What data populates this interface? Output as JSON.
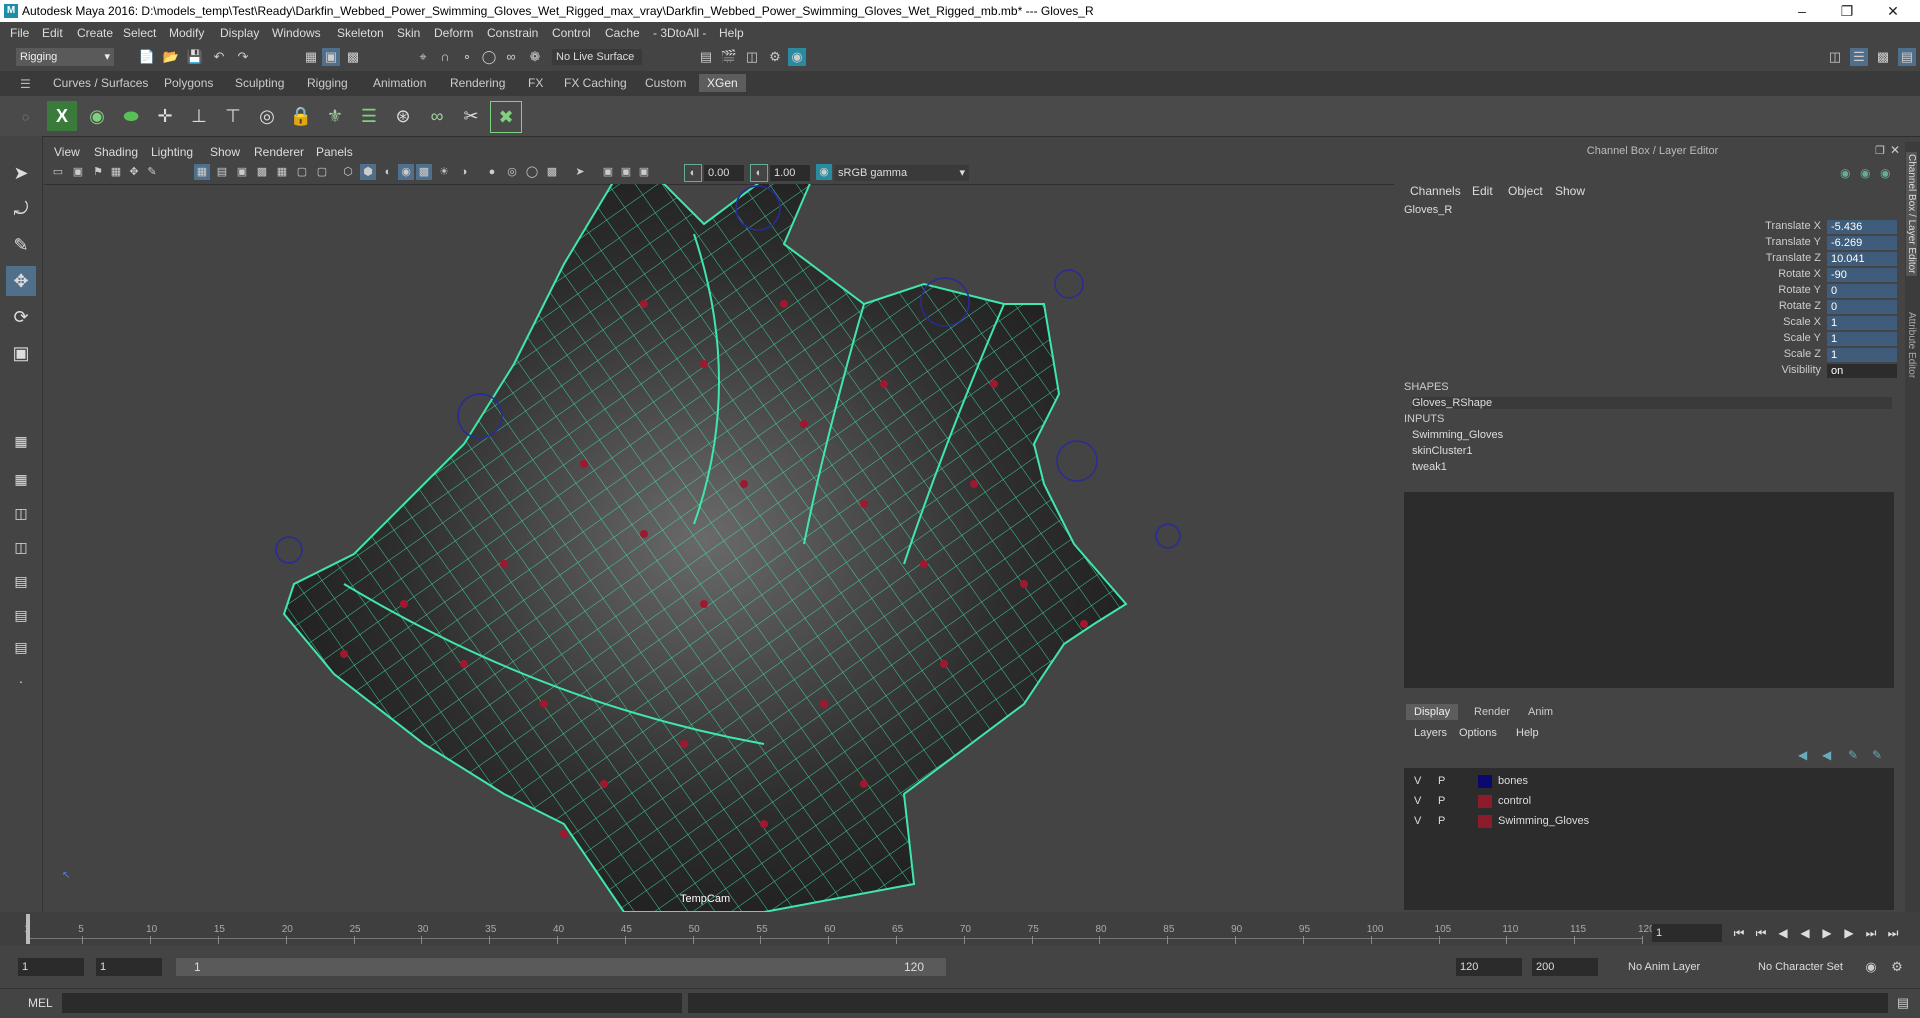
{
  "window": {
    "title": "Autodesk Maya 2016: D:\\models_temp\\Test\\Ready\\Darkfin_Webbed_Power_Swimming_Gloves_Wet_Rigged_max_vray\\Darkfin_Webbed_Power_Swimming_Gloves_Wet_Rigged_mb.mb*   ---   Gloves_R"
  },
  "menubar": [
    "File",
    "Edit",
    "Create",
    "Select",
    "Modify",
    "Display",
    "Windows",
    "Skeleton",
    "Skin",
    "Deform",
    "Constrain",
    "Control",
    "Cache",
    "- 3DtoAll -",
    "Help"
  ],
  "statusline": {
    "mode": "Rigging",
    "live_surface": "No Live Surface"
  },
  "shelf_tabs": [
    "Curves / Surfaces",
    "Polygons",
    "Sculpting",
    "Rigging",
    "Animation",
    "Rendering",
    "FX",
    "FX Caching",
    "Custom",
    "XGen"
  ],
  "shelf_active": "XGen",
  "viewport": {
    "menu": [
      "View",
      "Shading",
      "Lighting",
      "Show",
      "Renderer",
      "Panels"
    ],
    "exposure": "0.00",
    "gamma": "1.00",
    "colorspace": "sRGB gamma",
    "camera_label": "TempCam"
  },
  "channel_box": {
    "header": "Channel Box / Layer Editor",
    "menu": [
      "Channels",
      "Edit",
      "Object",
      "Show"
    ],
    "object": "Gloves_R",
    "channels": [
      {
        "label": "Translate X",
        "value": "-5.436"
      },
      {
        "label": "Translate Y",
        "value": "-6.269"
      },
      {
        "label": "Translate Z",
        "value": "10.041"
      },
      {
        "label": "Rotate X",
        "value": "-90"
      },
      {
        "label": "Rotate Y",
        "value": "0"
      },
      {
        "label": "Rotate Z",
        "value": "0"
      },
      {
        "label": "Scale X",
        "value": "1"
      },
      {
        "label": "Scale Y",
        "value": "1"
      },
      {
        "label": "Scale Z",
        "value": "1"
      },
      {
        "label": "Visibility",
        "value": "on"
      }
    ],
    "shapes_header": "SHAPES",
    "shapes": [
      "Gloves_RShape"
    ],
    "inputs_header": "INPUTS",
    "inputs": [
      "Swimming_Gloves",
      "skinCluster1",
      "tweak1"
    ]
  },
  "side_tabs": [
    "Channel Box / Layer Editor",
    "Attribute Editor"
  ],
  "layer_editor": {
    "tabs": [
      "Display",
      "Render",
      "Anim"
    ],
    "active_tab": "Display",
    "menu": [
      "Layers",
      "Options",
      "Help"
    ],
    "layers": [
      {
        "v": "V",
        "p": "P",
        "name": "bones",
        "color": "#0a0a6e"
      },
      {
        "v": "V",
        "p": "P",
        "name": "control",
        "color": "#8c1b2c"
      },
      {
        "v": "V",
        "p": "P",
        "name": "Swimming_Gloves",
        "color": "#8c1b2c"
      }
    ]
  },
  "timeline": {
    "ticks": [
      "1",
      "5",
      "10",
      "15",
      "20",
      "25",
      "30",
      "35",
      "40",
      "45",
      "50",
      "55",
      "60",
      "65",
      "70",
      "75",
      "80",
      "85",
      "90",
      "95",
      "100",
      "105",
      "110",
      "115",
      "120"
    ],
    "current_frame": "1"
  },
  "range": {
    "start": "1",
    "playback_start": "1",
    "slider_start": "1",
    "slider_end": "120",
    "playback_end": "120",
    "end": "200",
    "anim_layer": "No Anim Layer",
    "character_set": "No Character Set"
  },
  "cmdline": {
    "label": "MEL"
  }
}
